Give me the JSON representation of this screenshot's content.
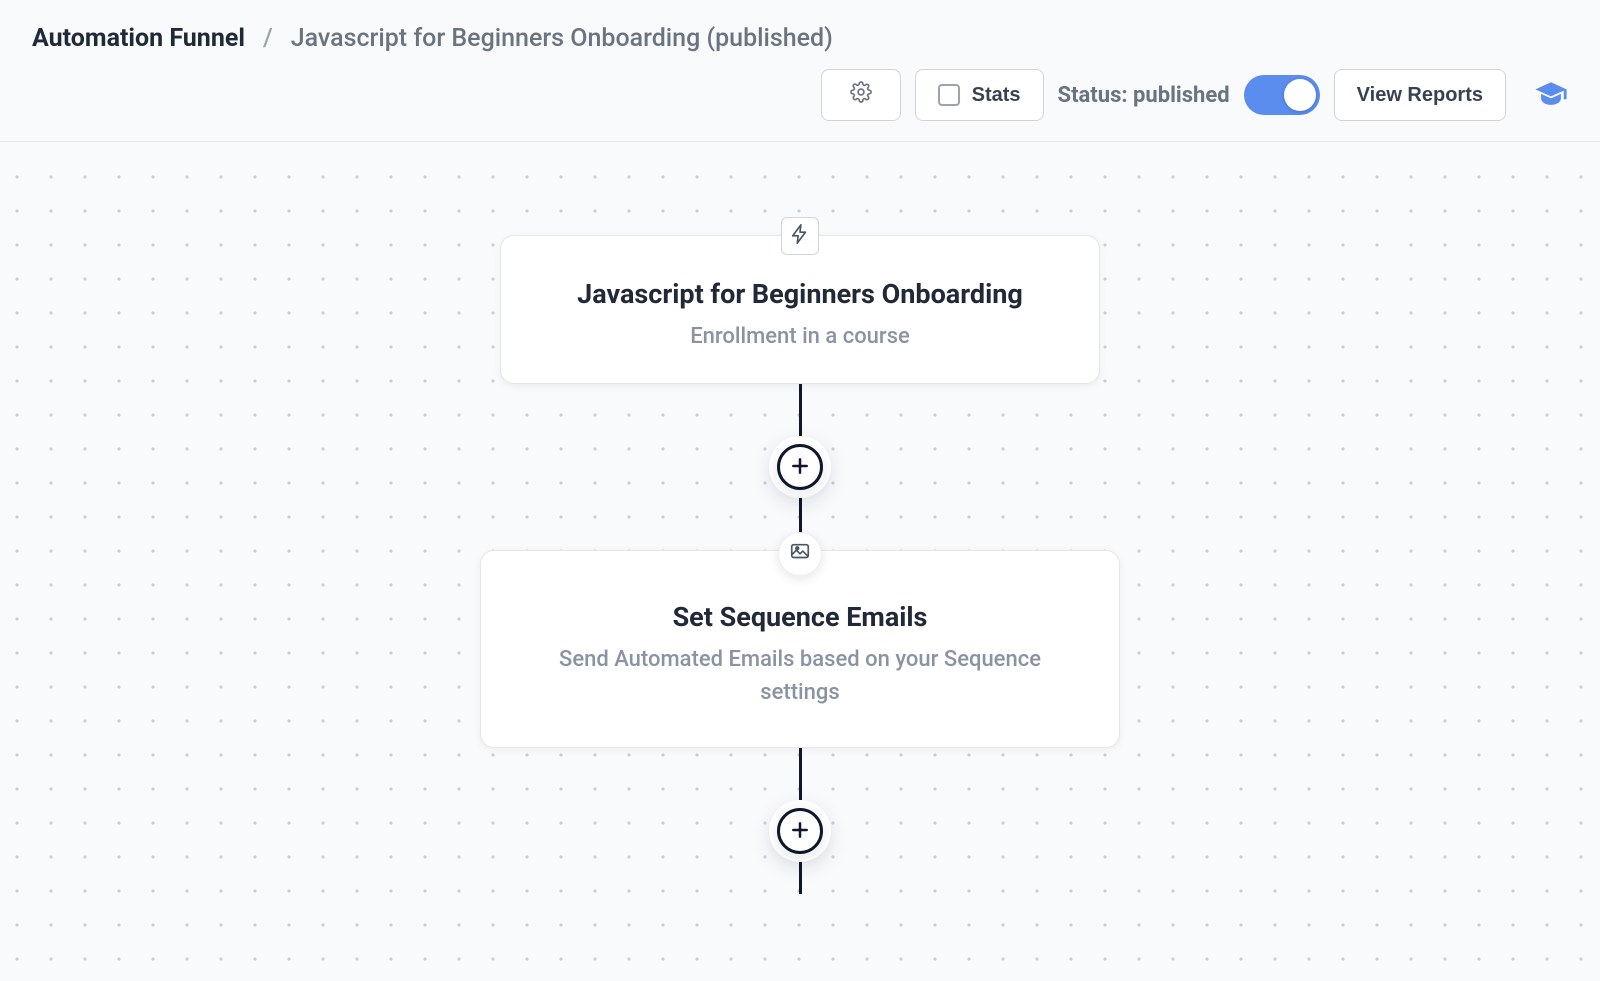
{
  "breadcrumb": {
    "root": "Automation Funnel",
    "current": "Javascript for Beginners Onboarding (published)"
  },
  "toolbar": {
    "stats_label": "Stats",
    "status_label": "Status: published",
    "view_reports_label": "View Reports",
    "toggle_on": true
  },
  "flow": {
    "node1": {
      "title": "Javascript for Beginners Onboarding",
      "subtitle": "Enrollment in a course",
      "badge_icon": "bolt-icon"
    },
    "node2": {
      "title": "Set Sequence Emails",
      "subtitle": "Send Automated Emails based on your Sequence settings",
      "badge_icon": "image-icon"
    }
  },
  "colors": {
    "accent": "#5b8def",
    "ink": "#0f172a",
    "muted": "#8b92a3"
  }
}
